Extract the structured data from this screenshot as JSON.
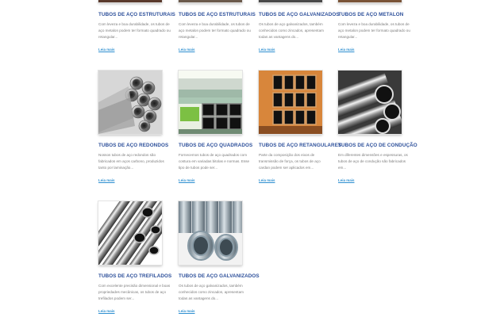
{
  "products": [
    {
      "title": "TUBOS DE AÇO ESTRUTURAIS",
      "description": "Com leveza e boa durabilidade, os tubos de aço metalon podem ter formato quadrado ou retangular...",
      "link": "Leia mais",
      "image": "steel-structural-tubes-image"
    },
    {
      "title": "TUBOS DE AÇO ESTRUTURAIS",
      "description": "Com leveza e boa durabilidade, os tubos de aço metalon podem ter formato quadrado ou retangular...",
      "link": "Leia mais",
      "image": "steel-structural-tubes-image"
    },
    {
      "title": "TUBOS DE AÇO GALVANIZADOS",
      "description": "Os tubos de aço galvanizados, também conhecidos como zincados, apresentam todas as vantagens do...",
      "link": "Leia mais",
      "image": "galvanized-tubes-image"
    },
    {
      "title": "TUBOS DE AÇO METALON",
      "description": "Com leveza e boa durabilidade, os tubos de aço metalon podem ter formato quadrado ou retangular...",
      "link": "Leia mais",
      "image": "metalon-tubes-image"
    },
    {
      "title": "TUBOS DE AÇO REDONDOS",
      "description": "Nossos tubos de aço redondos são fabricados em aços carbono, produzidos tanto por laminação...",
      "link": "Leia mais",
      "image": "round-tubes-image"
    },
    {
      "title": "TUBOS DE AÇO QUADRADOS",
      "description": "Fornecemos tubos de aço quadrados com costura em variadas bitolas e normas. Esse tipo de tubos pode ser...",
      "link": "Leia mais",
      "image": "square-tubes-image"
    },
    {
      "title": "TUBOS DE AÇO RETANGULARES",
      "description": "Parte da composição dos eixos de transmissão de força, os tubos de aço cardan podem ser aplicados em...",
      "link": "Leia mais",
      "image": "rectangular-tubes-image"
    },
    {
      "title": "TUBOS DE AÇO DE CONDUÇÃO",
      "description": "Em diferentes dimensões e espessuras, os tubos de aço de condução são fabricados em...",
      "link": "Leia mais",
      "image": "conduction-tubes-image"
    },
    {
      "title": "TUBOS DE AÇO TREFILADOS",
      "description": "Com excelente precisão dimensional e boas propriedades mecânicas, os tubos de aço trefilados podem ser...",
      "link": "Leia mais",
      "image": "drawn-tubes-image"
    },
    {
      "title": "TUBOS DE AÇO GALVANIZADOS",
      "description": "Os tubos de aço galvanizados, também conhecidos como zincados, apresentam todas as vantagens do...",
      "link": "Leia mais",
      "image": "galvanized-tubes-image"
    }
  ],
  "colors": {
    "title": "#2c4f9a",
    "link": "#2e8fd0",
    "text": "#7d7d7d"
  }
}
